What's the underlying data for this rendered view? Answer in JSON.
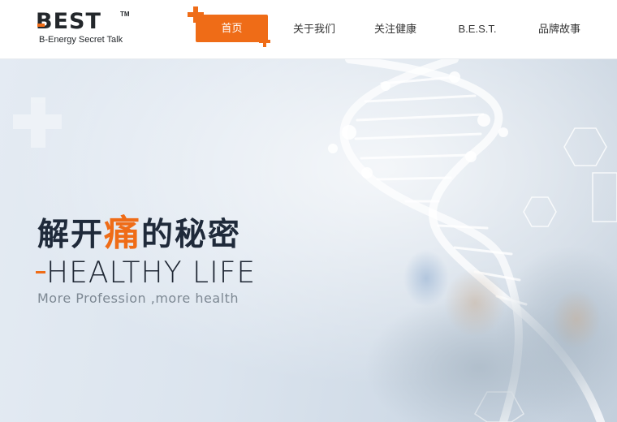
{
  "logo": {
    "mark": "BEST",
    "trademark": "TM",
    "tagline": "B-Energy Secret Talk"
  },
  "nav": {
    "items": [
      {
        "label": "首页",
        "active": true
      },
      {
        "label": "关于我们",
        "active": false
      },
      {
        "label": "关注健康",
        "active": false
      },
      {
        "label": "B.E.S.T.",
        "active": false
      },
      {
        "label": "品牌故事",
        "active": false
      }
    ]
  },
  "hero": {
    "title_before": "解开",
    "title_accent": "痛",
    "title_after": "的秘密",
    "subtitle": "HEALTHY LIFE",
    "tagline": "More Profession ,more health"
  },
  "colors": {
    "accent": "#ef6c17",
    "text_dark": "#1f2a3a",
    "text_muted": "#7d8893",
    "hero_bg": "#dbe4ee"
  }
}
